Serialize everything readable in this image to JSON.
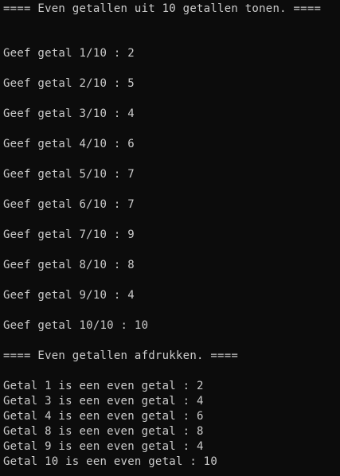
{
  "console": {
    "header": "==== Even getallen uit 10 getallen tonen. ====",
    "prompts": [
      "Geef getal 1/10 : 2",
      "Geef getal 2/10 : 5",
      "Geef getal 3/10 : 4",
      "Geef getal 4/10 : 6",
      "Geef getal 5/10 : 7",
      "Geef getal 6/10 : 7",
      "Geef getal 7/10 : 9",
      "Geef getal 8/10 : 8",
      "Geef getal 9/10 : 4",
      "Geef getal 10/10 : 10"
    ],
    "print_header": "==== Even getallen afdrukken. ====",
    "results": [
      "Getal 1 is een even getal : 2",
      "Getal 3 is een even getal : 4",
      "Getal 4 is een even getal : 6",
      "Getal 8 is een even getal : 8",
      "Getal 9 is een even getal : 4",
      "Getal 10 is een even getal : 10"
    ]
  }
}
